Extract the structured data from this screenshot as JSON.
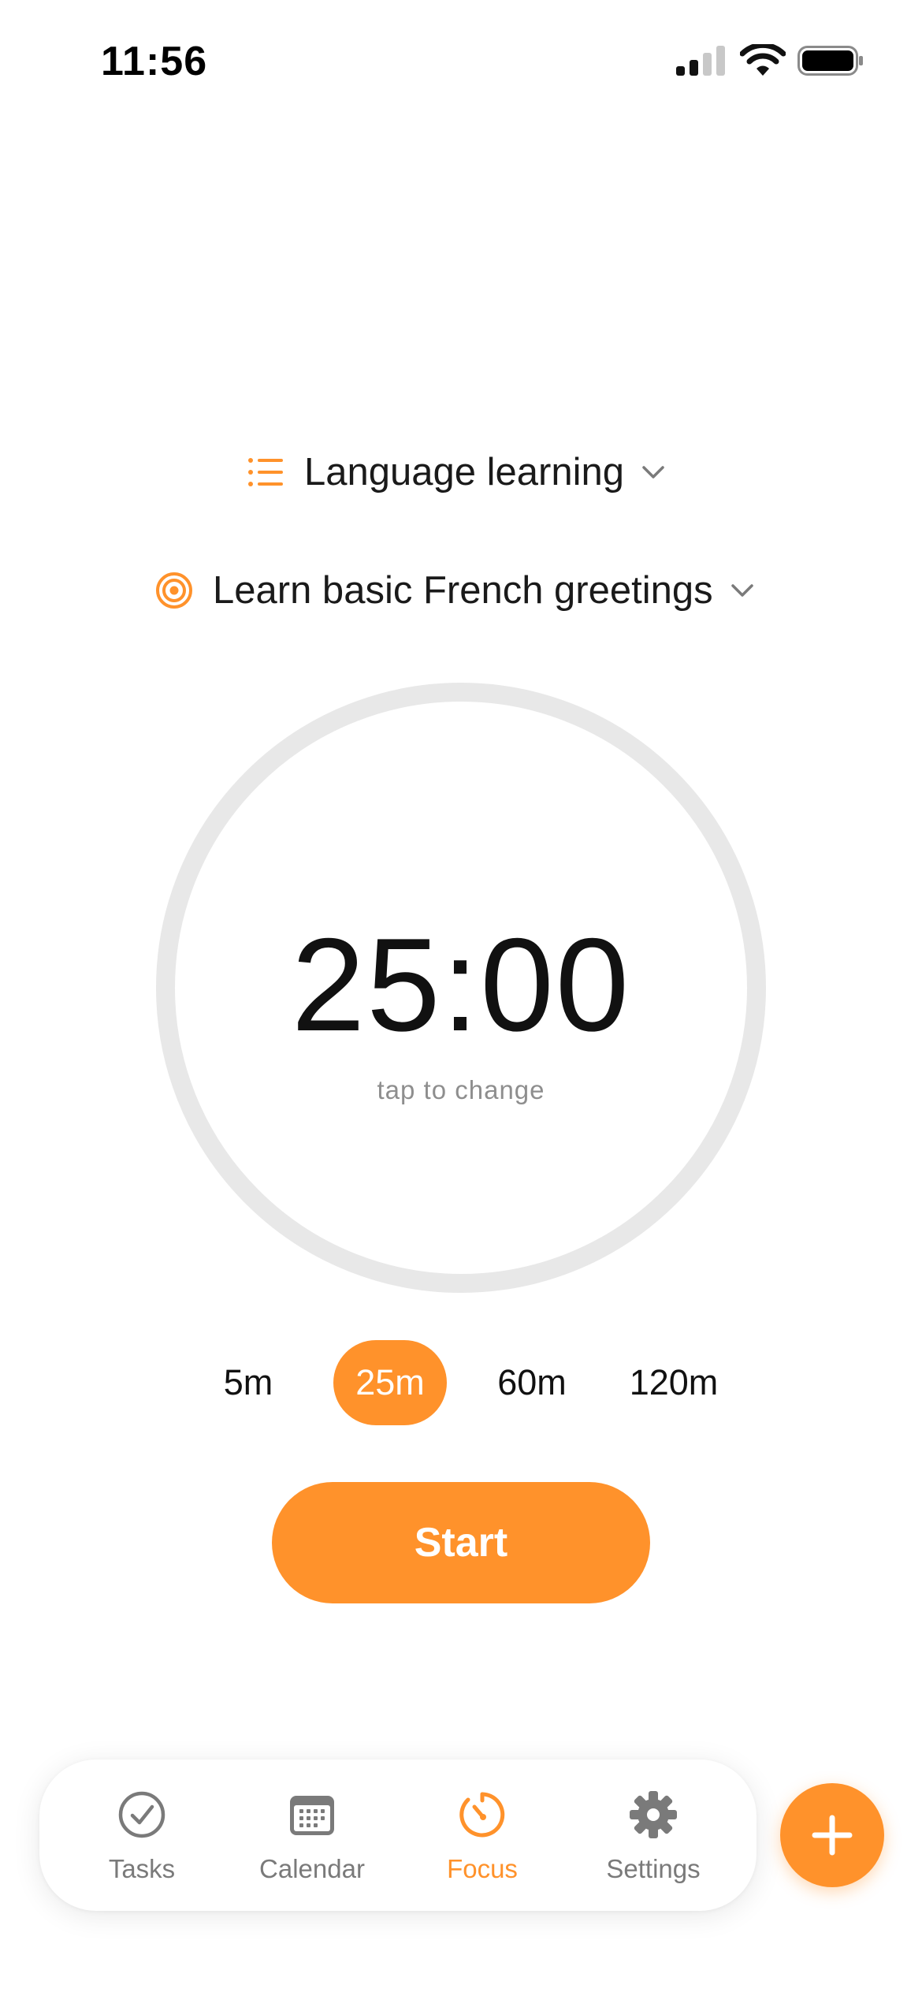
{
  "status_bar": {
    "time": "11:56",
    "signal_icon": "cellular-signal-icon",
    "wifi_icon": "wifi-icon",
    "battery_icon": "battery-icon"
  },
  "project_selector": {
    "label": "Language learning",
    "icon": "list-icon"
  },
  "goal_selector": {
    "label": "Learn basic French greetings",
    "icon": "target-icon"
  },
  "timer": {
    "value": "25:00",
    "hint": "tap to change"
  },
  "presets": {
    "items": [
      "5m",
      "25m",
      "60m",
      "120m"
    ],
    "selected": "25m"
  },
  "start_button": {
    "label": "Start"
  },
  "tab_bar": {
    "items": [
      {
        "label": "Tasks",
        "icon": "check-circle-icon"
      },
      {
        "label": "Calendar",
        "icon": "calendar-icon"
      },
      {
        "label": "Focus",
        "icon": "timer-icon"
      },
      {
        "label": "Settings",
        "icon": "gear-icon"
      }
    ],
    "active": "Focus"
  },
  "fab": {
    "icon": "plus-icon"
  },
  "colors": {
    "accent": "#ff922b",
    "ring": "#e8e8e8",
    "muted_text": "#8e8e8e",
    "tab_inactive": "#7a7a7a"
  }
}
